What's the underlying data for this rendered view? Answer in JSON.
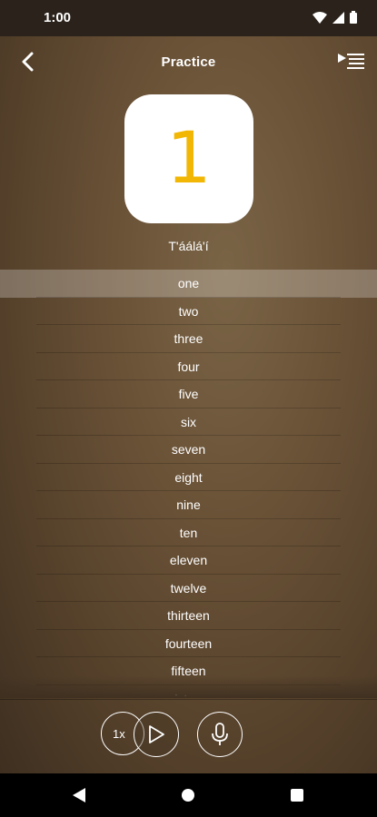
{
  "status_bar": {
    "time": "1:00"
  },
  "app_bar": {
    "title": "Practice"
  },
  "card": {
    "number": "1"
  },
  "native_word": "T'áálá'í",
  "list": {
    "active_index": 0,
    "items": [
      "one",
      "two",
      "three",
      "four",
      "five",
      "six",
      "seven",
      "eight",
      "nine",
      "ten",
      "eleven",
      "twelve",
      "thirteen",
      "fourteen",
      "fifteen",
      "sixteen"
    ]
  },
  "controls": {
    "speed_label": "1x"
  },
  "icons": {
    "back": "chevron-left-icon",
    "list": "play-list-icon",
    "play": "play-icon",
    "mic": "microphone-icon"
  },
  "colors": {
    "accent": "#f2b705"
  }
}
